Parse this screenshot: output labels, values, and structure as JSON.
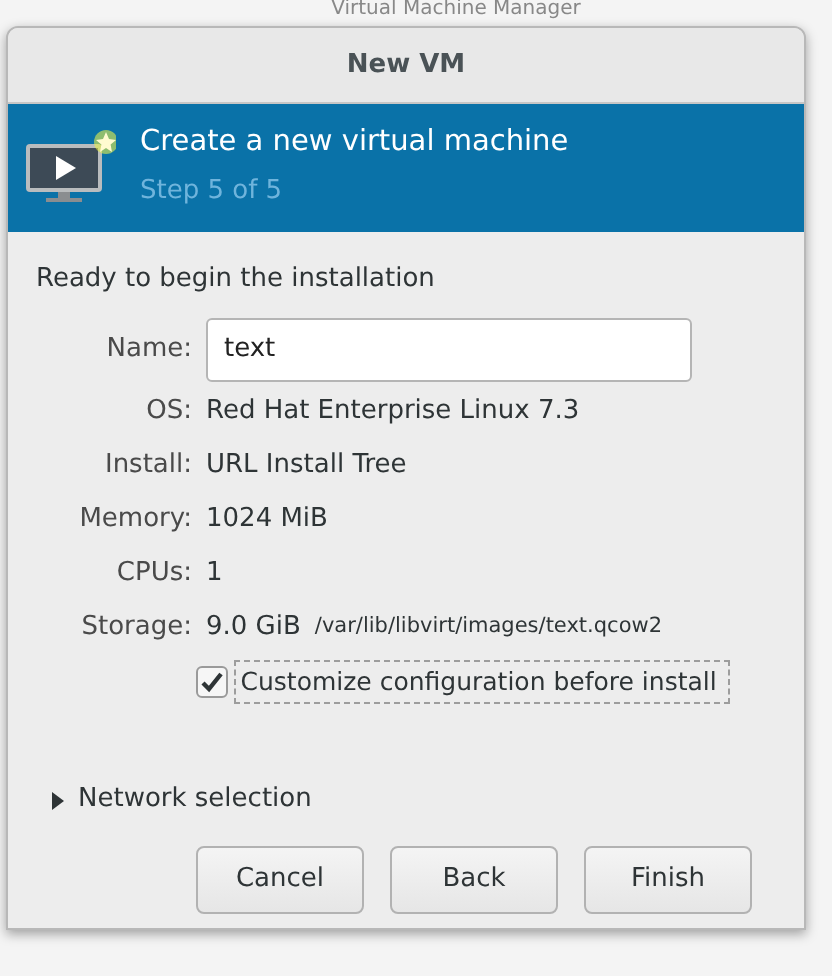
{
  "background_window": {
    "title": "Virtual Machine Manager"
  },
  "dialog": {
    "title": "New VM"
  },
  "banner": {
    "title": "Create a new virtual machine",
    "step": "Step 5 of 5"
  },
  "heading": "Ready to begin the installation",
  "name_field": {
    "label": "Name:",
    "value": "text"
  },
  "details": [
    {
      "label": "OS:",
      "value": "Red Hat Enterprise Linux 7.3"
    },
    {
      "label": "Install:",
      "value": "URL Install Tree"
    },
    {
      "label": "Memory:",
      "value": "1024 MiB"
    },
    {
      "label": "CPUs:",
      "value": "1"
    },
    {
      "label": "Storage:",
      "value": "9.0 GiB",
      "path": "/var/lib/libvirt/images/text.qcow2"
    }
  ],
  "customize": {
    "label": "Customize configuration before install",
    "checked": true,
    "focused": true
  },
  "network_selection": {
    "label": "Network selection",
    "expanded": false
  },
  "buttons": [
    "Cancel",
    "Back",
    "Finish"
  ]
}
